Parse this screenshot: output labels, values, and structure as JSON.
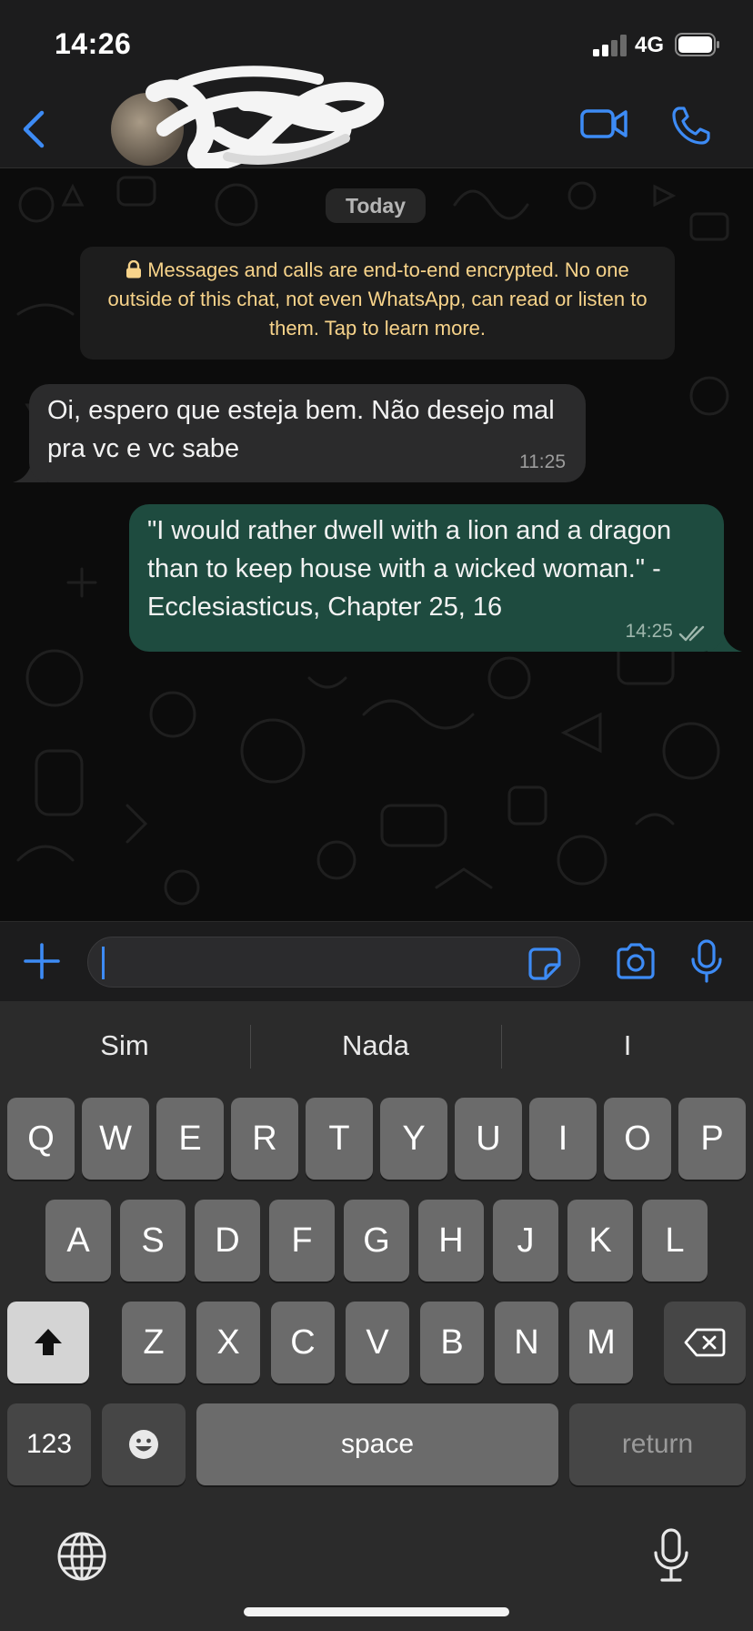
{
  "status_bar": {
    "time": "14:26",
    "network": "4G"
  },
  "header": {
    "contact_name": ""
  },
  "chat": {
    "date_label": "Today",
    "encryption_notice": "Messages and calls are end-to-end encrypted. No one outside of this chat, not even WhatsApp, can read or listen to them. Tap to learn more.",
    "messages": [
      {
        "direction": "incoming",
        "text": "Oi, espero que esteja bem. Não desejo mal pra vc e vc sabe",
        "time": "11:25"
      },
      {
        "direction": "outgoing",
        "text": "\"I would rather dwell with a lion and a dragon than to keep house with a wicked woman.\" - Ecclesiasticus, Chapter 25, 16",
        "time": "14:25",
        "status": "read"
      }
    ]
  },
  "composer": {
    "value": "",
    "placeholder": ""
  },
  "keyboard": {
    "suggestions": [
      "Sim",
      "Nada",
      "I"
    ],
    "row1": [
      "Q",
      "W",
      "E",
      "R",
      "T",
      "Y",
      "U",
      "I",
      "O",
      "P"
    ],
    "row2": [
      "A",
      "S",
      "D",
      "F",
      "G",
      "H",
      "J",
      "K",
      "L"
    ],
    "row3": [
      "Z",
      "X",
      "C",
      "V",
      "B",
      "N",
      "M"
    ],
    "numbers_label": "123",
    "space_label": "space",
    "return_label": "return"
  },
  "colors": {
    "accent": "#3d8bf5",
    "incoming_bubble": "#2b2b2c",
    "outgoing_bubble": "#1e4b3f",
    "notice_text": "#f7d38a"
  },
  "icons": {
    "back": "chevron-left-icon",
    "video": "video-camera-icon",
    "call": "phone-icon",
    "plus": "plus-icon",
    "sticker": "sticker-icon",
    "camera": "camera-icon",
    "mic": "microphone-icon",
    "shift": "shift-arrow-icon",
    "delete": "backspace-icon",
    "emoji": "emoji-icon",
    "globe": "globe-icon",
    "dictation": "dictation-mic-icon"
  }
}
